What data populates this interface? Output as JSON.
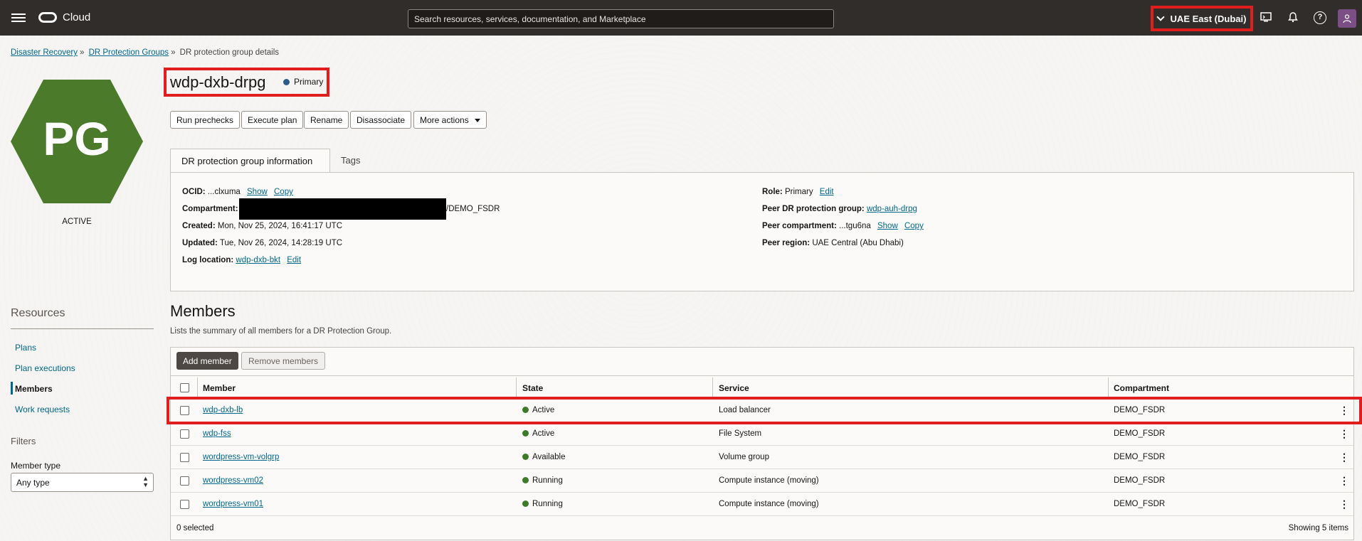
{
  "topbar": {
    "logo_text": "Cloud",
    "search_placeholder": "Search resources, services, documentation, and Marketplace",
    "region": "UAE East (Dubai)"
  },
  "breadcrumb": {
    "items": [
      "Disaster Recovery",
      "DR Protection Groups",
      "DR protection group details"
    ]
  },
  "resource": {
    "initials": "PG",
    "status": "ACTIVE",
    "hex_color": "#4a7a2a",
    "name": "wdp-dxb-drpg",
    "role_badge": "Primary"
  },
  "actions": {
    "run_prechecks": "Run prechecks",
    "execute_plan": "Execute plan",
    "rename": "Rename",
    "disassociate": "Disassociate",
    "more_actions": "More actions"
  },
  "tabs": [
    "DR protection group information",
    "Tags"
  ],
  "info": {
    "ocid_label": "OCID:",
    "ocid_value": "...clxuma",
    "show": "Show",
    "copy": "Copy",
    "compartment_label": "Compartment:",
    "compartment_value": "/DEMO_FSDR",
    "created_label": "Created:",
    "created_value": "Mon, Nov 25, 2024, 16:41:17 UTC",
    "updated_label": "Updated:",
    "updated_value": "Tue, Nov 26, 2024, 14:28:19 UTC",
    "log_label": "Log location:",
    "log_value": "wdp-dxb-bkt",
    "edit": "Edit",
    "role_label": "Role:",
    "role_value": "Primary",
    "peer_group_label": "Peer DR protection group:",
    "peer_group_value": "wdp-auh-drpg",
    "peer_compartment_label": "Peer compartment:",
    "peer_compartment_value": "...tgu6na",
    "peer_region_label": "Peer region:",
    "peer_region_value": "UAE Central (Abu Dhabi)"
  },
  "sidebar": {
    "resources_title": "Resources",
    "items": [
      "Plans",
      "Plan executions",
      "Members",
      "Work requests"
    ],
    "active_item": "Members",
    "filters_title": "Filters",
    "member_type_label": "Member type",
    "member_type_value": "Any type"
  },
  "members": {
    "title": "Members",
    "description": "Lists the summary of all members for a DR Protection Group.",
    "add_button": "Add member",
    "remove_button": "Remove members",
    "columns": [
      "Member",
      "State",
      "Service",
      "Compartment"
    ],
    "rows": [
      {
        "member": "wdp-dxb-lb",
        "state": "Active",
        "service": "Load balancer",
        "compartment": "DEMO_FSDR"
      },
      {
        "member": "wdp-fss",
        "state": "Active",
        "service": "File System",
        "compartment": "DEMO_FSDR"
      },
      {
        "member": "wordpress-vm-volgrp",
        "state": "Available",
        "service": "Volume group",
        "compartment": "DEMO_FSDR"
      },
      {
        "member": "wordpress-vm02",
        "state": "Running",
        "service": "Compute instance (moving)",
        "compartment": "DEMO_FSDR"
      },
      {
        "member": "wordpress-vm01",
        "state": "Running",
        "service": "Compute instance (moving)",
        "compartment": "DEMO_FSDR"
      }
    ],
    "selected_text": "0 selected",
    "showing_text": "Showing 5 items"
  },
  "colors": {
    "topbar": "#312d2a",
    "highlight": "#e01e1e",
    "link": "#00688c",
    "state_green": "#3c7a28"
  }
}
